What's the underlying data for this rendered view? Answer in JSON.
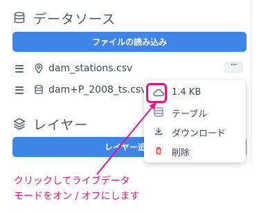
{
  "datasource": {
    "title": "データソース",
    "load_button": "ファイルの読み込み",
    "files": [
      {
        "name": "dam_stations.csv",
        "icon": "location-pin-icon"
      },
      {
        "name": "dam+P_2008_ts.csv",
        "icon": "database-icon"
      }
    ],
    "more_label": "···"
  },
  "layers": {
    "title": "レイヤー",
    "add_button": "レイヤー追加"
  },
  "context_menu": {
    "size": "1.4 KB",
    "table": "テーブル",
    "download": "ダウンロード",
    "delete": "削除"
  },
  "annotation": {
    "line1": "クリックしてライブデータ",
    "line2": "モードをオン / オフにします"
  },
  "colors": {
    "primary": "#3d85e6",
    "annotation": "#e01383",
    "delete": "#e53935"
  }
}
